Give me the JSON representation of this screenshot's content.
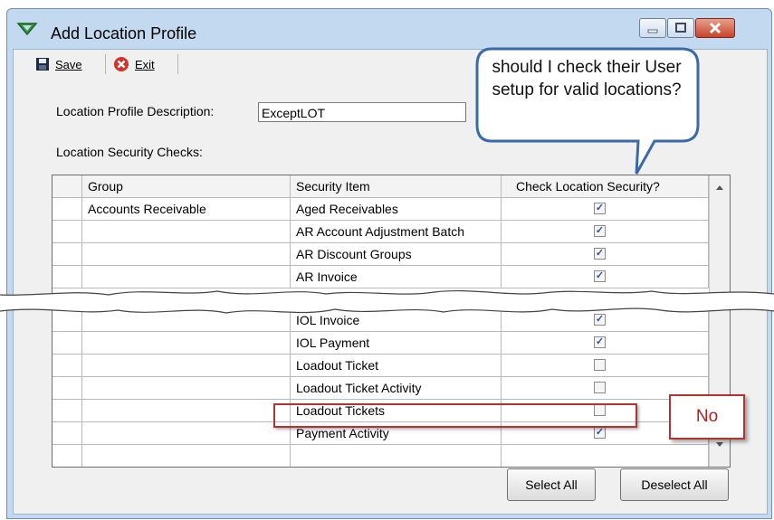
{
  "window": {
    "title": "Add Location Profile"
  },
  "toolbar": {
    "save_label": "Save",
    "exit_label": "Exit"
  },
  "form": {
    "description_label": "Location Profile Description:",
    "description_value": "ExceptLOT",
    "checks_label": "Location Security Checks:"
  },
  "grid": {
    "headers": [
      "Group",
      "Security Item",
      "Check Location Security?"
    ],
    "rows_top": [
      {
        "group": "Accounts Receivable",
        "item": "Aged Receivables",
        "checked": true
      },
      {
        "group": "",
        "item": "AR Account Adjustment Batch",
        "checked": true
      },
      {
        "group": "",
        "item": "AR Discount Groups",
        "checked": true
      },
      {
        "group": "",
        "item": "AR Invoice",
        "checked": true
      }
    ],
    "rows_bottom": [
      {
        "group": "",
        "item": "IOL Invoice",
        "checked": true
      },
      {
        "group": "",
        "item": "IOL Payment",
        "checked": true
      },
      {
        "group": "",
        "item": "Loadout Ticket",
        "checked": false
      },
      {
        "group": "",
        "item": "Loadout Ticket Activity",
        "checked": false
      },
      {
        "group": "",
        "item": "Loadout Tickets",
        "checked": false
      },
      {
        "group": "",
        "item": "Payment Activity",
        "checked": true
      }
    ]
  },
  "buttons": {
    "select_all": "Select All",
    "deselect_all": "Deselect All"
  },
  "annotations": {
    "callout": "should I check their User setup for valid locations?",
    "no_label": "No"
  },
  "colors": {
    "highlight": "#b5332e",
    "checkmark": "#2e4fa8"
  }
}
